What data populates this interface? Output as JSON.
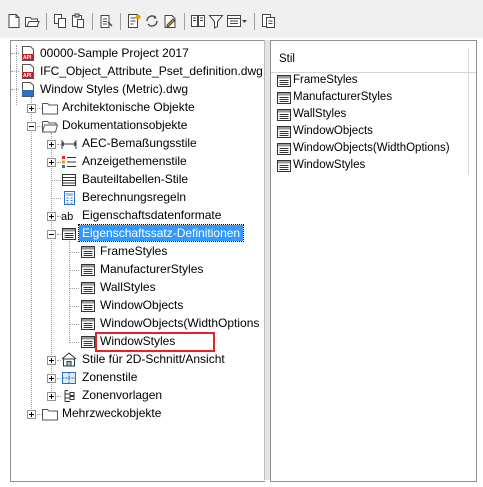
{
  "toolbar": {
    "icons": [
      "new-document-icon",
      "open-folder-icon",
      "copy-icon",
      "paste-icon",
      "purge-icon",
      "properties-icon",
      "refresh-icon",
      "edit-icon",
      "filter-icon",
      "filter-funnel-icon",
      "view-options-icon",
      "drop-down-icon",
      "export-icon"
    ]
  },
  "tree": {
    "items": [
      {
        "label": "00000-Sample Project 2017",
        "icon": "dwg-red-icon"
      },
      {
        "label": "IFC_Object_Attribute_Pset_definition.dwg",
        "icon": "dwg-red-icon"
      },
      {
        "label": "Window Styles (Metric).dwg",
        "icon": "dwg-blue-icon"
      },
      {
        "label": "Architektonische Objekte",
        "icon": "folder-icon"
      },
      {
        "label": "Dokumentationsobjekte",
        "icon": "folder-open-icon"
      },
      {
        "label": "AEC-Bemaßungsstile",
        "icon": "dimension-icon"
      },
      {
        "label": "Anzeigethemenstile",
        "icon": "display-theme-icon"
      },
      {
        "label": "Bauteiltabellen-Stile",
        "icon": "table-icon"
      },
      {
        "label": "Berechnungsregeln",
        "icon": "calc-rule-icon"
      },
      {
        "label": "Eigenschaftsdatenformate",
        "icon": "data-format-icon"
      },
      {
        "label": "Eigenschaftssatz-Definitionen",
        "icon": "property-set-icon"
      },
      {
        "label": "FrameStyles",
        "icon": "property-set-icon"
      },
      {
        "label": "ManufacturerStyles",
        "icon": "property-set-icon"
      },
      {
        "label": "WallStyles",
        "icon": "property-set-icon"
      },
      {
        "label": "WindowObjects",
        "icon": "property-set-icon"
      },
      {
        "label": "WindowObjects(WidthOptions",
        "icon": "property-set-icon"
      },
      {
        "label": "WindowStyles",
        "icon": "property-set-icon"
      },
      {
        "label": "Stile für 2D-Schnitt/Ansicht",
        "icon": "section-2d-icon"
      },
      {
        "label": "Zonenstile",
        "icon": "zone-style-icon"
      },
      {
        "label": "Zonenvorlagen",
        "icon": "zone-template-icon"
      },
      {
        "label": "Mehrzweckobjekte",
        "icon": "folder-icon"
      }
    ]
  },
  "list": {
    "header": "Stil",
    "rows": [
      {
        "label": "FrameStyles"
      },
      {
        "label": "ManufacturerStyles"
      },
      {
        "label": "WallStyles"
      },
      {
        "label": "WindowObjects"
      },
      {
        "label": "WindowObjects(WidthOptions)"
      },
      {
        "label": "WindowStyles"
      }
    ]
  }
}
